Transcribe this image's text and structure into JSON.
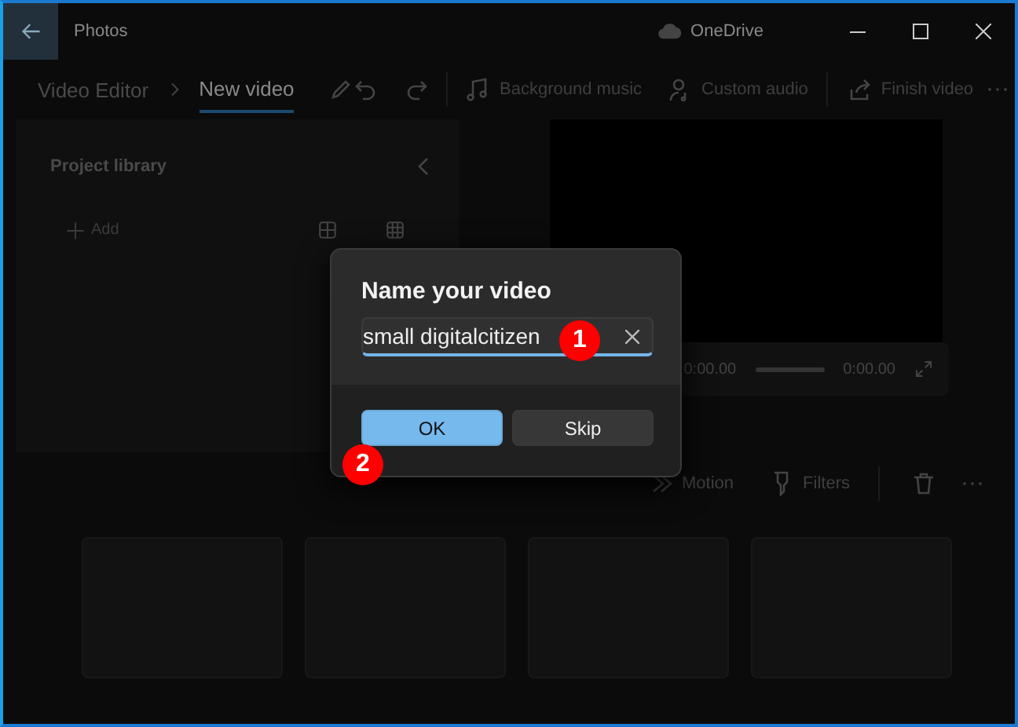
{
  "window": {
    "title": "Photos",
    "cloud": "OneDrive"
  },
  "toolbar": {
    "breadcrumb": [
      {
        "label": "Video Editor",
        "current": false
      },
      {
        "label": "New video",
        "current": true
      }
    ],
    "actions": [
      {
        "label": "Background music",
        "kind": "music"
      },
      {
        "label": "Custom audio",
        "kind": "audio"
      },
      {
        "label": "Finish video",
        "kind": "share"
      }
    ]
  },
  "library": {
    "title": "Project library",
    "add": "Add"
  },
  "player": {
    "start_time": "0:00.00",
    "end_time": "0:00.00"
  },
  "storyboard": {
    "tools": [
      {
        "label": "Motion",
        "kind": "motion"
      },
      {
        "label": "Filters",
        "kind": "filters"
      }
    ]
  },
  "dialog": {
    "title": "Name your video",
    "input": {
      "value": "small digitalcitizen"
    },
    "buttons": [
      {
        "label": "OK",
        "kind": "primary"
      },
      {
        "label": "Skip",
        "kind": "secondary"
      }
    ]
  },
  "annotations": [
    {
      "label": "1"
    },
    {
      "label": "2"
    }
  ]
}
